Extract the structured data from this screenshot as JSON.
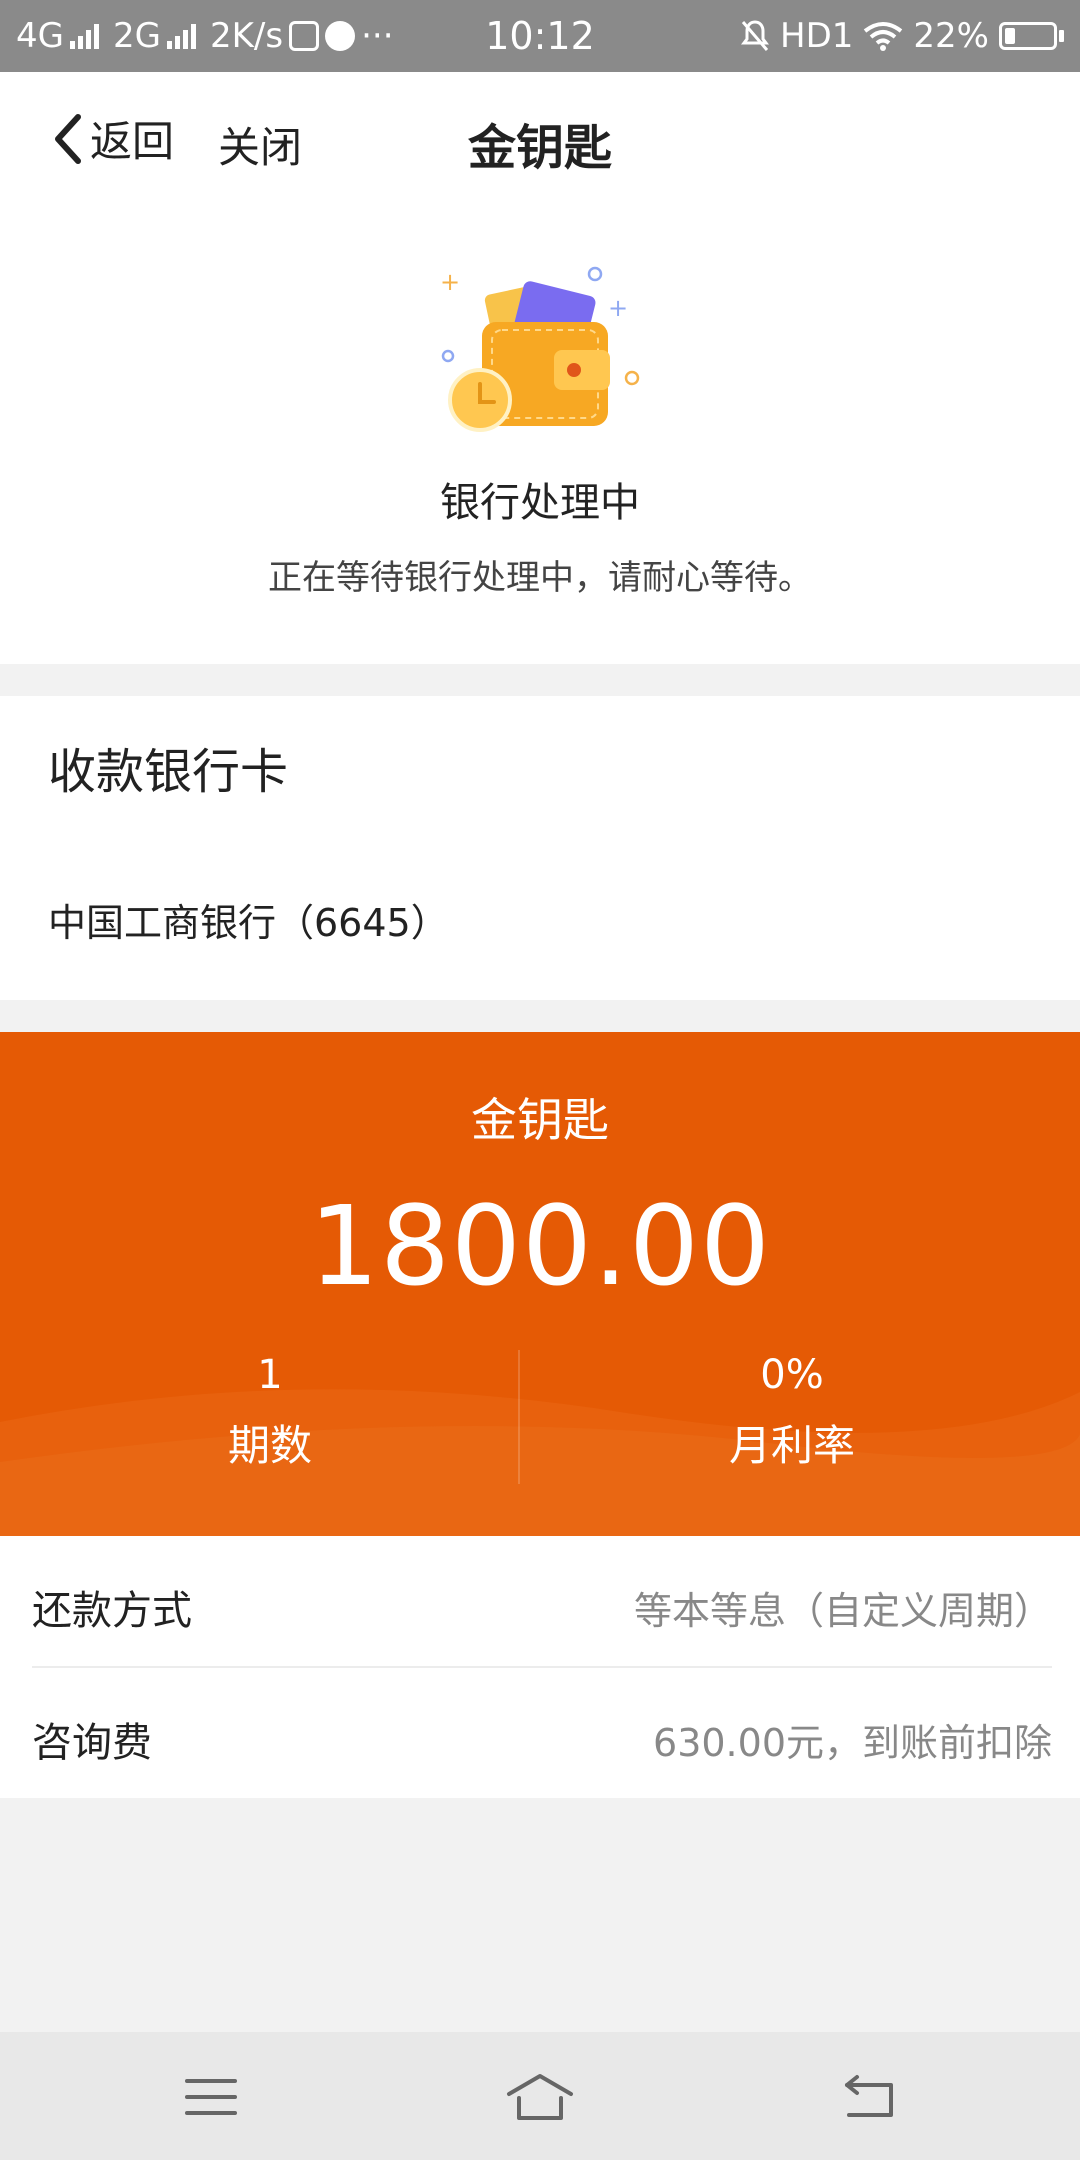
{
  "status_bar": {
    "network_1": "4G",
    "network_2": "2G",
    "speed": "2K/s",
    "time": "10:12",
    "hd": "HD1",
    "battery": "22%",
    "battery_level": 0.22,
    "more": "···"
  },
  "nav": {
    "back_label": "返回",
    "close_label": "关闭",
    "title": "金钥匙"
  },
  "status": {
    "title": "银行处理中",
    "description": "正在等待银行处理中，请耐心等待。"
  },
  "bank": {
    "heading": "收款银行卡",
    "name": "中国工商银行（6645）"
  },
  "loan": {
    "product": "金钥匙",
    "amount": "1800.00",
    "periods_value": "1",
    "periods_label": "期数",
    "rate_value": "0%",
    "rate_label": "月利率"
  },
  "details": [
    {
      "label": "还款方式",
      "value": "等本等息（自定义周期）"
    },
    {
      "label": "咨询费",
      "value": "630.00元，到账前扣除"
    }
  ],
  "colors": {
    "accent": "#e55a05",
    "status_bar": "#8a8a8a"
  },
  "bottom_nav": [
    "menu-icon",
    "home-icon",
    "back-icon"
  ]
}
